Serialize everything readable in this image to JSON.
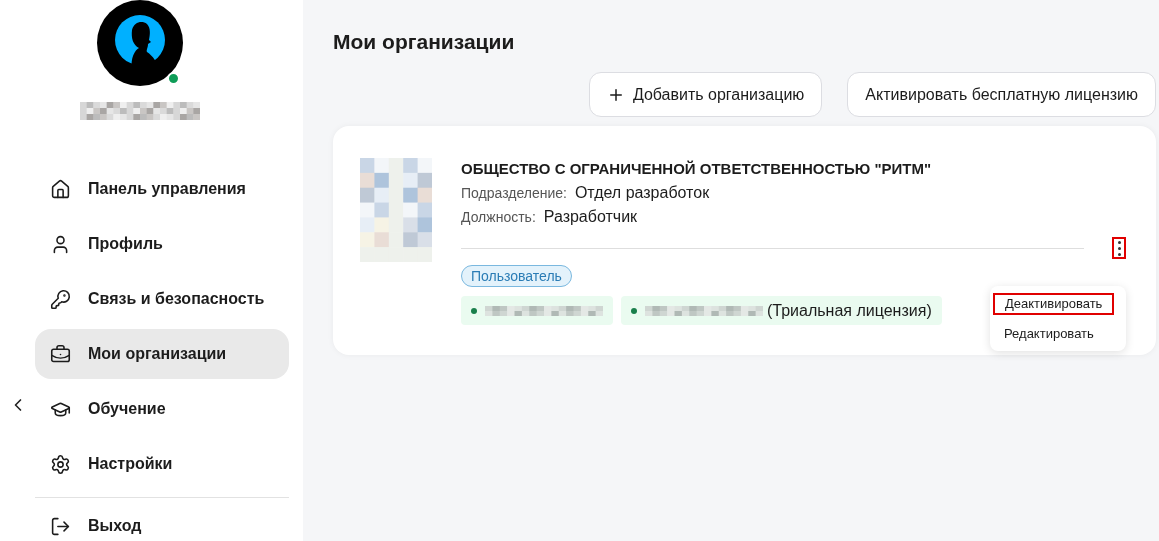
{
  "sidebar": {
    "user": {
      "online": true
    },
    "items": [
      {
        "label": "Панель управления",
        "selected": false
      },
      {
        "label": "Профиль",
        "selected": false
      },
      {
        "label": "Связь и безопасность",
        "selected": false
      },
      {
        "label": "Мои организации",
        "selected": true
      },
      {
        "label": "Обучение",
        "selected": false
      },
      {
        "label": "Настройки",
        "selected": false
      }
    ],
    "logout": {
      "label": "Выход"
    }
  },
  "page": {
    "title": "Мои организации",
    "buttons": [
      {
        "label": "Добавить организацию",
        "kind": "add"
      },
      {
        "label": "Активировать бесплатную лицензию",
        "kind": "plain"
      }
    ]
  },
  "organization": {
    "name": "ОБЩЕСТВО С ОГРАНИЧЕННОЙ ОТВЕТСТВЕННОСТЬЮ \"РИТМ\"",
    "fields": [
      {
        "label": "Подразделение:",
        "value": "Отдел разработок"
      },
      {
        "label": "Должность:",
        "value": "Разработчик"
      }
    ],
    "role": "Пользователь",
    "licenses": [
      {
        "color": "#1a7f4b"
      },
      {
        "color": "#1a7f4b",
        "note": "(Триальная лицензия)"
      }
    ],
    "menu_button": {
      "highlighted": true
    },
    "menu": {
      "open": true,
      "items": [
        {
          "label": "Деактивировать",
          "highlighted": true
        },
        {
          "label": "Редактировать",
          "highlighted": false
        }
      ]
    }
  }
}
